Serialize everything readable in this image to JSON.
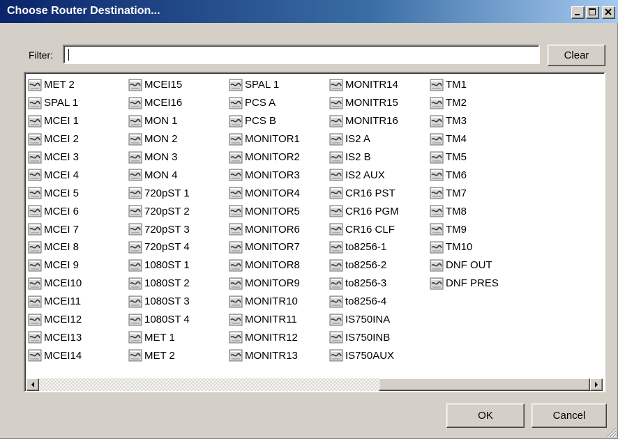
{
  "window": {
    "title": "Choose Router Destination..."
  },
  "filter": {
    "label": "Filter:",
    "value": "",
    "clear_label": "Clear"
  },
  "columns": [
    [
      "MET 2",
      "SPAL 1",
      "MCEI 1",
      "MCEI 2",
      "MCEI 3",
      "MCEI 4",
      "MCEI 5",
      "MCEI 6",
      "MCEI 7",
      "MCEI 8",
      "MCEI 9",
      "MCEI10",
      "MCEI11",
      "MCEI12",
      "MCEI13",
      "MCEI14"
    ],
    [
      "MCEI15",
      "MCEI16",
      "MON 1",
      "MON 2",
      "MON 3",
      "MON 4",
      "720pST 1",
      "720pST 2",
      "720pST 3",
      "720pST 4",
      "1080ST 1",
      "1080ST 2",
      "1080ST 3",
      "1080ST 4",
      "MET 1",
      "MET 2"
    ],
    [
      "SPAL 1",
      "PCS A",
      "PCS B",
      "MONITOR1",
      "MONITOR2",
      "MONITOR3",
      "MONITOR4",
      "MONITOR5",
      "MONITOR6",
      "MONITOR7",
      "MONITOR8",
      "MONITOR9",
      "MONITR10",
      "MONITR11",
      "MONITR12",
      "MONITR13"
    ],
    [
      "MONITR14",
      "MONITR15",
      "MONITR16",
      "IS2 A",
      "IS2 B",
      "IS2 AUX",
      "CR16 PST",
      "CR16 PGM",
      "CR16 CLF",
      "to8256-1",
      "to8256-2",
      "to8256-3",
      "to8256-4",
      "IS750INA",
      "IS750INB",
      "IS750AUX"
    ],
    [
      "TM1",
      "TM2",
      "TM3",
      "TM4",
      "TM5",
      "TM6",
      "TM7",
      "TM8",
      "TM9",
      "TM10",
      "DNF OUT",
      "DNF PRES"
    ]
  ],
  "item_icon": "router-destination-icon",
  "buttons": {
    "ok": "OK",
    "cancel": "Cancel"
  },
  "colors": {
    "titlebar_start": "#0a246a",
    "titlebar_end": "#a6caf0",
    "face": "#d4d0c8"
  }
}
